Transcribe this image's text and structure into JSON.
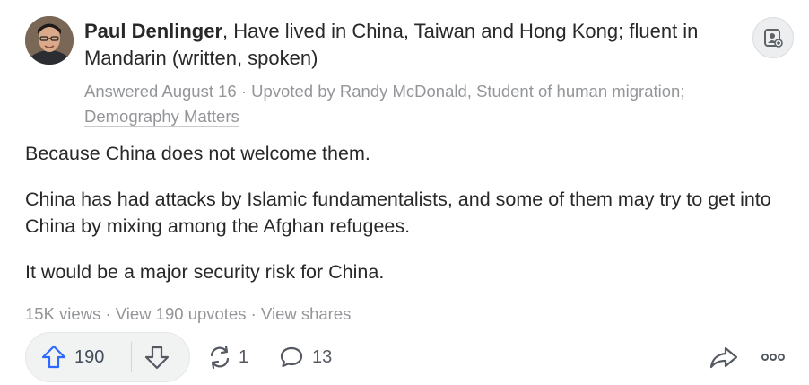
{
  "answer": {
    "author_name": "Paul Denlinger",
    "author_credential": ", Have lived in China, Taiwan and Hong Kong; fluent in Mandarin (written, spoken)",
    "answered_date": "Answered August 16",
    "meta_separator": " · ",
    "upvoted_by": "Upvoted by Randy McDonald, ",
    "upvoter_credential": "Student of human migration; Demography Matters",
    "paragraphs": [
      "Because China does not welcome them.",
      "China has had attacks by Islamic fundamentalists, and some of them may try to get into China by mixing among the Afghan refugees.",
      "It would be a major security risk for China."
    ]
  },
  "stats": {
    "views": "15K views",
    "separator": " · ",
    "view_upvotes": "View 190 upvotes",
    "view_shares": "View shares"
  },
  "actions": {
    "upvote_count": "190",
    "share_count": "1",
    "comment_count": "13"
  },
  "icons": {
    "follow": "follow-user-icon",
    "upvote": "arrow-up-icon",
    "downvote": "arrow-down-icon",
    "share": "share-cycle-icon",
    "comment": "comment-bubble-icon",
    "forward": "forward-arrow-icon",
    "more": "more-dots-icon"
  },
  "colors": {
    "upvote_blue": "#2e69ff",
    "meta_gray": "#939598",
    "text": "#282829"
  }
}
